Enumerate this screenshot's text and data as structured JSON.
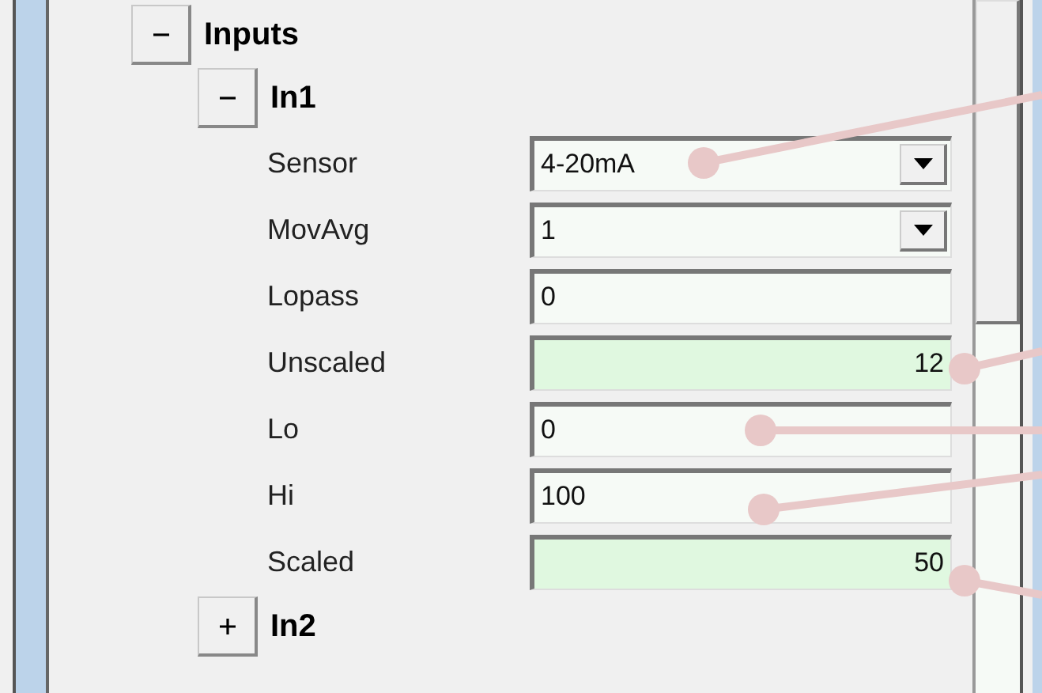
{
  "tree": [
    {
      "label": "Inputs",
      "expanded": true,
      "children": [
        {
          "label": "In1",
          "expanded": true,
          "properties": [
            {
              "label": "Sensor",
              "kind": "combo",
              "value": "4-20mA"
            },
            {
              "label": "MovAvg",
              "kind": "combo",
              "value": "1"
            },
            {
              "label": "Lopass",
              "kind": "text",
              "value": "0"
            },
            {
              "label": "Unscaled",
              "kind": "readout",
              "value": "12"
            },
            {
              "label": "Lo",
              "kind": "text",
              "value": "0"
            },
            {
              "label": "Hi",
              "kind": "text",
              "value": "100"
            },
            {
              "label": "Scaled",
              "kind": "readout",
              "value": "50"
            }
          ]
        },
        {
          "label": "In2",
          "expanded": false
        }
      ]
    }
  ]
}
